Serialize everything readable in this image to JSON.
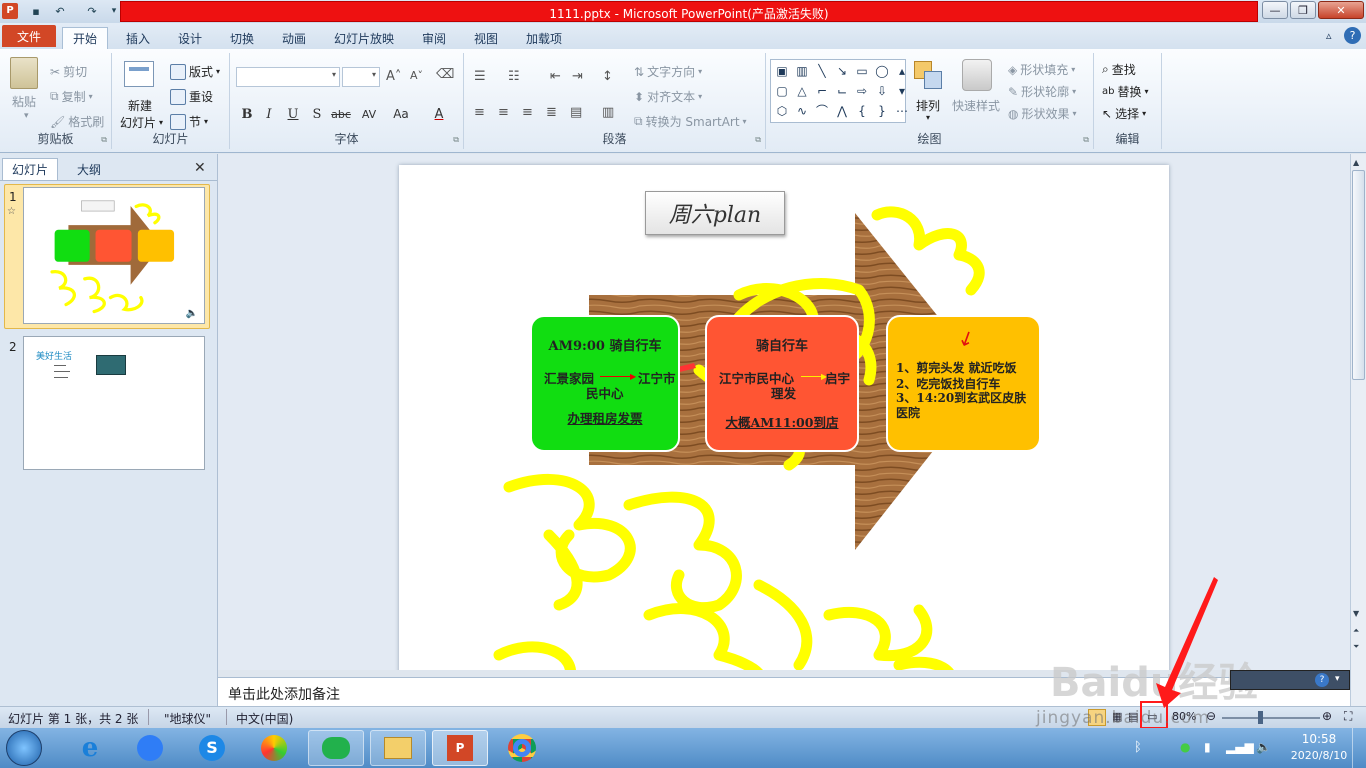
{
  "window": {
    "title": "1111.pptx - Microsoft PowerPoint(产品激活失败)",
    "help": "?"
  },
  "tabs": [
    {
      "label": "文件"
    },
    {
      "label": "开始"
    },
    {
      "label": "插入"
    },
    {
      "label": "设计"
    },
    {
      "label": "切换"
    },
    {
      "label": "动画"
    },
    {
      "label": "幻灯片放映"
    },
    {
      "label": "审阅"
    },
    {
      "label": "视图"
    },
    {
      "label": "加载项"
    }
  ],
  "ribbon": {
    "clipboard": {
      "paste": "粘贴",
      "cut": "剪切",
      "copy": "复制",
      "painter": "格式刷",
      "label": "剪贴板"
    },
    "slides": {
      "new_slide": "新建",
      "new_slide2": "幻灯片",
      "layout": "版式",
      "reset": "重设",
      "section": "节",
      "label": "幻灯片"
    },
    "font": {
      "label": "字体"
    },
    "paragraph": {
      "text_dir": "文字方向",
      "align_text": "对齐文本",
      "smartart": "转换为 SmartArt",
      "label": "段落"
    },
    "drawing": {
      "arrange": "排列",
      "quick_styles": "快速样式",
      "fill": "形状填充",
      "outline": "形状轮廓",
      "effects": "形状效果",
      "label": "绘图"
    },
    "editing": {
      "find": "查找",
      "replace": "替换",
      "select": "选择",
      "label": "编辑"
    }
  },
  "pane": {
    "tab_slides": "幻灯片",
    "tab_outline": "大纲",
    "slide1_num": "1",
    "slide2_num": "2",
    "slide2_title": "美好生活"
  },
  "slide": {
    "title": "周六plan",
    "box1": {
      "title": "AM9:00 骑自行车",
      "from": "汇景家园",
      "to": "江宁市",
      "to2": "民中心",
      "link": "办理租房发票",
      "color": "#11dd11"
    },
    "box2": {
      "title": "骑自行车",
      "from": "江宁市民中心",
      "to": "启宇",
      "to2": "理发",
      "link": "大概AM11:00到店",
      "color": "#ff5533"
    },
    "box3": {
      "line1": "1、剪完头发 就近吃饭",
      "line2": "2、吃完饭找自行车",
      "line3": "3、14:20到玄武区皮肤医院",
      "color": "#ffc000"
    }
  },
  "notes": {
    "placeholder": "单击此处添加备注"
  },
  "status": {
    "slide_info": "幻灯片 第 1 张，共 2 张",
    "theme": "\"地球仪\"",
    "language": "中文(中国)",
    "zoom": "80%"
  },
  "watermark": {
    "text": "Baidu经验",
    "url": "jingyan.baidu.com"
  },
  "taskbar": {
    "time": "10:58",
    "date": "2020/8/10"
  }
}
